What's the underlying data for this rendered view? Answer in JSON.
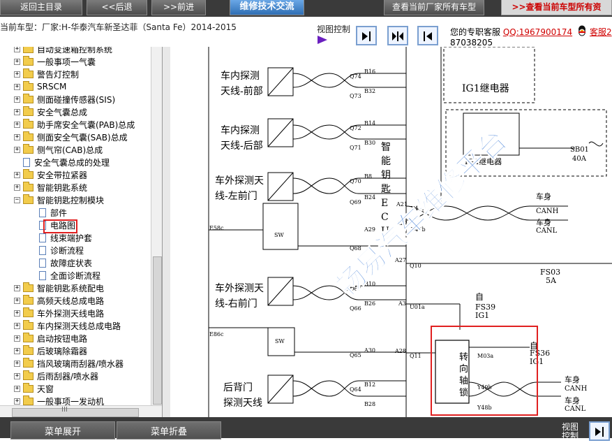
{
  "toolbar": {
    "home_label": "返回主目录",
    "back_label": "<<后退",
    "forward_label": ">>前进",
    "tech_label": "维修技术交流",
    "current_label": "查看当前厂家所有车型",
    "all_label": ">>查看当前车型所有资"
  },
  "info": {
    "current_car": "当前车型：厂家:H-华泰汽车新圣达菲（Santa Fe）2014-2015",
    "view_control": "视图控制",
    "service_prefix": "您的专职客服",
    "service_qq": "QQ:1967900174",
    "service_tail": "客服2",
    "service_line2": "87038205"
  },
  "tree": {
    "items": [
      {
        "label": "自动变速箱控制系统",
        "type": "folder"
      },
      {
        "label": "一般事项一气囊",
        "type": "folder"
      },
      {
        "label": "警告灯控制",
        "type": "folder"
      },
      {
        "label": "SRSCM",
        "type": "folder"
      },
      {
        "label": "侧面碰撞传感器(SIS)",
        "type": "folder"
      },
      {
        "label": "安全气囊总成",
        "type": "folder"
      },
      {
        "label": "助手席安全气囊(PAB)总成",
        "type": "folder"
      },
      {
        "label": "侧面安全气囊(SAB)总成",
        "type": "folder"
      },
      {
        "label": "侧气帘(CAB)总成",
        "type": "folder"
      },
      {
        "label": "安全气囊总成的处理",
        "type": "doc"
      },
      {
        "label": "安全带拉紧器",
        "type": "folder"
      },
      {
        "label": "智能钥匙系统",
        "type": "folder"
      },
      {
        "label": "智能钥匙控制模块",
        "type": "folder-open"
      },
      {
        "label": "部件",
        "type": "doc-child"
      },
      {
        "label": "电路图",
        "type": "doc-child"
      },
      {
        "label": "线束端护套",
        "type": "doc-child"
      },
      {
        "label": "诊断流程",
        "type": "doc-child"
      },
      {
        "label": "故障症状表",
        "type": "doc-child"
      },
      {
        "label": "全面诊断流程",
        "type": "doc-child"
      },
      {
        "label": "智能钥匙系统配电",
        "type": "folder"
      },
      {
        "label": "高频天线总成电路",
        "type": "folder"
      },
      {
        "label": "车外探测天线电路",
        "type": "folder"
      },
      {
        "label": "车内探测天线总成电路",
        "type": "folder"
      },
      {
        "label": "启动按钮电路",
        "type": "folder"
      },
      {
        "label": "后玻璃除霜器",
        "type": "folder"
      },
      {
        "label": "挡风玻璃雨刮器/喷水器",
        "type": "folder"
      },
      {
        "label": "后雨刮器/喷水器",
        "type": "folder"
      },
      {
        "label": "天窗",
        "type": "folder"
      },
      {
        "label": "一般事项一发动机",
        "type": "folder"
      }
    ],
    "hscroll_grip": "III"
  },
  "diagram": {
    "watermark": "畅易汽车维修平台",
    "labels": {
      "ant_front": [
        "车内探测",
        "天线-前部"
      ],
      "ant_rear": [
        "车内探测",
        "天线-后部"
      ],
      "ant_left": [
        "车外探测天",
        "线-左前门"
      ],
      "ant_right": [
        "车外探测天",
        "线-右前门"
      ],
      "ant_back": [
        "后背门",
        "探测天线"
      ],
      "ecu": [
        "智",
        "能",
        "钥",
        "匙",
        "E",
        "C",
        "U"
      ],
      "ig1": "IG1继电器",
      "ig2": "IG2继电器",
      "lock": [
        "转",
        "向",
        "轴",
        "锁"
      ],
      "canh": "CANH",
      "canl": "CANL",
      "body": "车身",
      "from": "自",
      "fs39": "FS39",
      "fs36": "FS36",
      "ig1b": "IG1",
      "fs03": "FS03",
      "fs03a": "5A",
      "sb01": "SB01",
      "sb01a": "40A",
      "e58": "E58c",
      "e86": "E86c",
      "sw": "SW",
      "pins": [
        "B16",
        "B32",
        "B14",
        "B30",
        "B8",
        "B24",
        "A29",
        "B10",
        "B26",
        "A30",
        "B12",
        "B28",
        "A21",
        "A22",
        "A27",
        "A3",
        "A28"
      ],
      "wires": [
        "Q74",
        "Q73",
        "Q72",
        "Q71",
        "Q70",
        "Q69",
        "Q68",
        "Q67",
        "Q66",
        "Q65",
        "Q64",
        "Y49b",
        "Y48b",
        "Q10",
        "U01a",
        "Q11",
        "M03a",
        "Y49b",
        "Y48b"
      ]
    }
  },
  "bottom": {
    "expand_label": "菜单展开",
    "collapse_label": "菜单折叠",
    "view_label": "视图控制"
  }
}
